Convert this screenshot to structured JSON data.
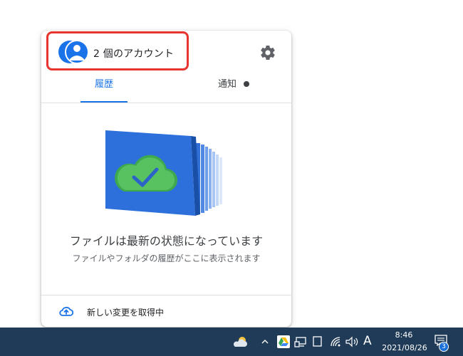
{
  "panel": {
    "account_label": "2 個のアカウント",
    "tabs": [
      {
        "label": "履歴",
        "active": true
      },
      {
        "label": "通知",
        "active": false
      }
    ],
    "status_title": "ファイルは最新の状態になっています",
    "status_subtitle": "ファイルやフォルダの履歴がここに表示されます",
    "footer_label": "新しい変更を取得中"
  },
  "taskbar": {
    "ime_indicator": "A",
    "clock_time": "8:46",
    "clock_date": "2021/08/26",
    "notification_count": "3",
    "tray_icons": [
      "weather-cloud-icon",
      "chevron-up-icon",
      "google-drive-icon",
      "network-pc-icon",
      "tablet-icon",
      "wifi-icon",
      "speaker-icon"
    ]
  },
  "colors": {
    "accent": "#1a73e8",
    "highlight": "#e8342f",
    "taskbar": "#203b57"
  }
}
